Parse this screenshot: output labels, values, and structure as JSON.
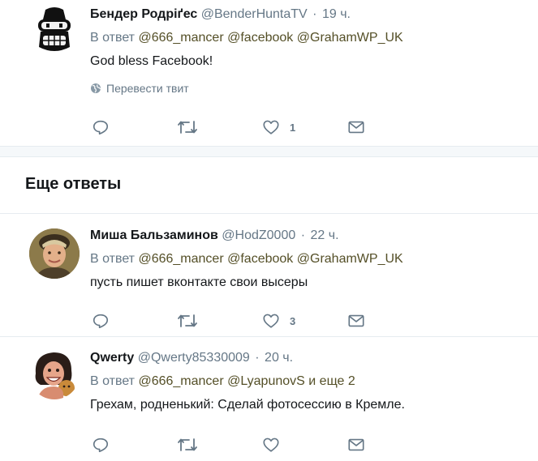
{
  "tweets": [
    {
      "name": "Бендер Родріґес",
      "handle": "@BenderHuntaTV",
      "sep": "·",
      "time": "19 ч.",
      "reply_prefix": "В ответ",
      "mentions": [
        "@666_mancer",
        "@facebook",
        "@GrahamWP_UK"
      ],
      "text": "God bless Facebook!",
      "translate": "Перевести твит",
      "like_count": "1"
    },
    {
      "name": "Миша Бальзаминов",
      "handle": "@HodZ0000",
      "sep": "·",
      "time": "22 ч.",
      "reply_prefix": "В ответ",
      "mentions": [
        "@666_mancer",
        "@facebook",
        "@GrahamWP_UK"
      ],
      "text": "пусть пишет вконтакте свои высеры",
      "like_count": "3"
    },
    {
      "name": "Qwerty",
      "handle": "@Qwerty85330009",
      "sep": "·",
      "time": "20 ч.",
      "reply_prefix": "В ответ",
      "mentions": [
        "@666_mancer",
        "@LyapunovS"
      ],
      "mention_suffix": "и еще 2",
      "text": "Грехам, родненький: Сделай фотосессию в Кремле."
    }
  ],
  "section_title": "Еще ответы",
  "colors": {
    "mention": "#544f27",
    "secondary": "#657786",
    "divider": "#e6ecf0"
  },
  "icons": [
    "reply-icon",
    "retweet-icon",
    "like-icon",
    "message-icon",
    "globe-icon"
  ]
}
